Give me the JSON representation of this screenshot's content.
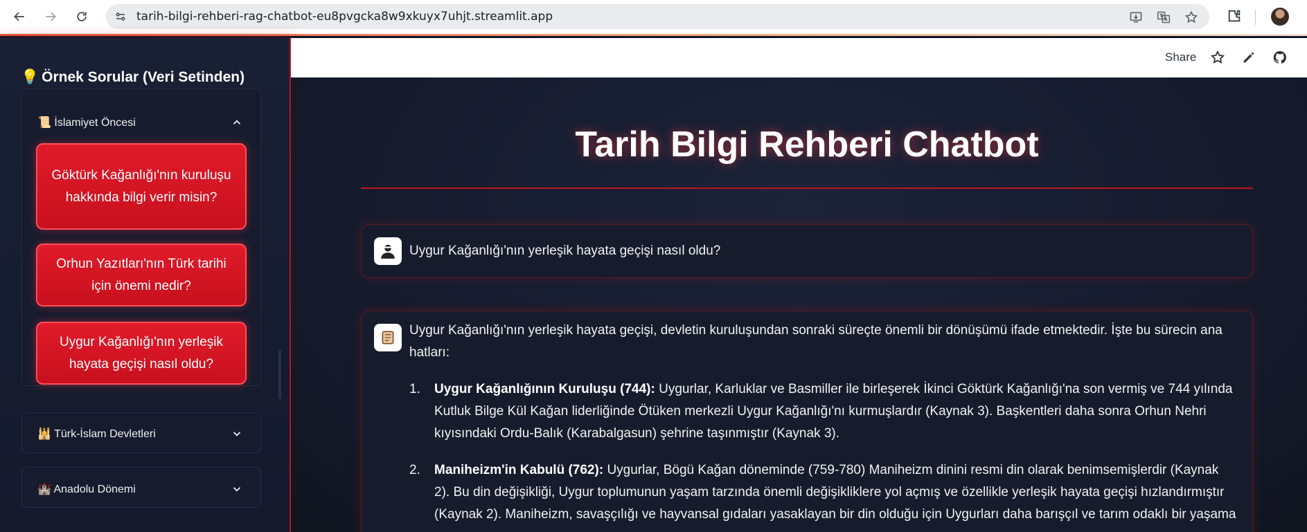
{
  "browser": {
    "url": "tarih-bilgi-rehberi-rag-chatbot-eu8pvgcka8w9xkuyx7uhjt.streamlit.app",
    "icons": [
      "back-icon",
      "forward-icon",
      "reload-icon",
      "site-settings-icon",
      "install-app-icon",
      "translate-icon",
      "bookmark-star-icon",
      "extensions-icon",
      "profile-avatar"
    ]
  },
  "sidebar": {
    "title_emoji": "💡",
    "title": "Örnek Sorular (Veri Setinden)",
    "sections": [
      {
        "icon": "📜",
        "label": "İslamiyet Öncesi",
        "expanded": true,
        "questions": [
          "Göktürk Kağanlığı'nın kuruluşu hakkında bilgi verir misin?",
          "Orhun Yazıtları'nın Türk tarihi için önemi nedir?",
          "Uygur Kağanlığı'nın yerleşik hayata geçişi nasıl oldu?"
        ]
      },
      {
        "icon": "🕌",
        "label": "Türk-İslam Devletleri",
        "expanded": false
      },
      {
        "icon": "🏰",
        "label": "Anadolu Dönemi",
        "expanded": false
      }
    ]
  },
  "toolbar": {
    "share_label": "Share",
    "icons": [
      "star-icon",
      "edit-icon",
      "github-icon"
    ]
  },
  "main": {
    "title": "Tarih Bilgi Rehberi Chatbot",
    "messages": [
      {
        "role": "user",
        "avatar": "user-avatar-icon",
        "text": "Uygur Kağanlığı'nın yerleşik hayata geçişi nasıl oldu?"
      },
      {
        "role": "assistant",
        "avatar": "scroll-avatar-icon",
        "intro": "Uygur Kağanlığı'nın yerleşik hayata geçişi, devletin kuruluşundan sonraki süreçte önemli bir dönüşümü ifade etmektedir. İşte bu sürecin ana hatları:",
        "items": [
          {
            "num": "1.",
            "heading": "Uygur Kağanlığının Kuruluşu (744):",
            "text": "Uygurlar, Karluklar ve Basmiller ile birleşerek İkinci Göktürk Kağanlığı'na son vermiş ve 744 yılında Kutluk Bilge Kül Kağan liderliğinde Ötüken merkezli Uygur Kağanlığı'nı kurmuşlardır (Kaynak 3). Başkentleri daha sonra Orhun Nehri kıyısındaki Ordu-Balık (Karabalgasun) şehrine taşınmıştır (Kaynak 3)."
          },
          {
            "num": "2.",
            "heading": "Maniheizm'in Kabulü (762):",
            "text": "Uygurlar, Bögü Kağan döneminde (759-780) Maniheizm dinini resmi din olarak benimsemişlerdir (Kaynak 2). Bu din değişikliği, Uygur toplumunun yaşam tarzında önemli değişikliklere yol açmış ve özellikle yerleşik hayata geçişi hızlandırmıştır (Kaynak 2). Maniheizm, savaşçılığı ve hayvansal gıdaları yasaklayan bir din olduğu için Uygurları daha barışçıl ve tarım odaklı bir yaşama"
          }
        ]
      }
    ]
  }
}
